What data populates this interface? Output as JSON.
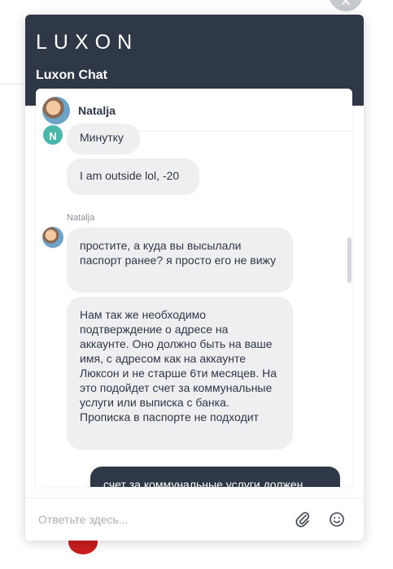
{
  "widget": {
    "logo": "LUXON",
    "title": "Luxon Chat",
    "close_glyph": "✕"
  },
  "agent": {
    "name": "Natalja",
    "avatar": "agent-photo"
  },
  "messages": [
    {
      "text": "Минутку",
      "from": "agent"
    },
    {
      "text": "I am outside lol, -20",
      "from": "agent"
    },
    {
      "sender": "Natalja"
    },
    {
      "text": "простите, а куда вы высылали паспорт ранее? я просто его не вижу",
      "from": "agent"
    },
    {
      "text": "Нам так же необходимо подтверждение о адресе на аккаунте. Оно должно быть на ваше имя, с адресом как на аккаунте Люксон и не старше 6ти месяцев. На это подойдет счет за коммунальные услуги или выписка с банка. Прописка в паспорте не подходит",
      "from": "agent"
    },
    {
      "text": "счет за коммунальные услуги должен",
      "from": "user"
    }
  ],
  "avatar_initial": "N",
  "input": {
    "placeholder": "Ответьте здесь...",
    "value": ""
  },
  "icons": {
    "attach": "paperclip-icon",
    "emoji": "smiley-icon"
  },
  "colors": {
    "header": "#2e3846",
    "bubble_agent": "#efeff1",
    "bubble_user": "#2e3846",
    "avatar_teal": "#4db6ac"
  }
}
